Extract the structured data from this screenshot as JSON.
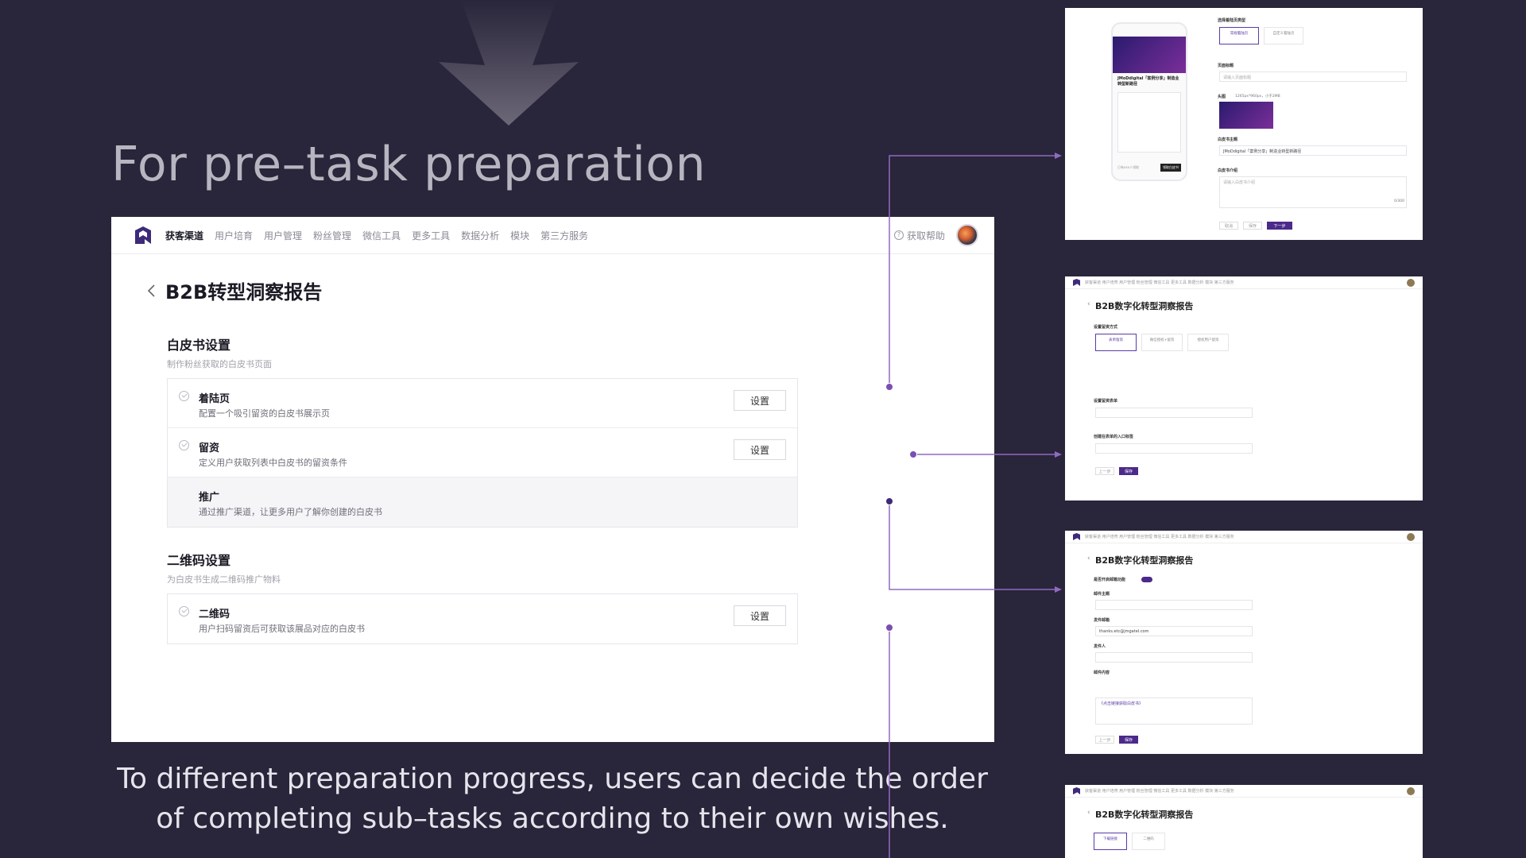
{
  "headline": "For pre–task preparation",
  "caption": "To different preparation progress, users can decide the order of completing sub–tasks according to their own wishes.",
  "colors": {
    "background": "#29253a",
    "accent": "#7a4fb2",
    "connector": "#8e6bbf"
  },
  "app": {
    "nav": {
      "logo": "logo-icon",
      "items": [
        "获客渠道",
        "用户培育",
        "用户管理",
        "粉丝管理",
        "微信工具",
        "更多工具",
        "数据分析",
        "模块",
        "第三方服务"
      ],
      "help": "获取帮助"
    },
    "page_title": "B2B转型洞察报告",
    "sections": [
      {
        "title": "白皮书设置",
        "subtitle": "制作粉丝获取的白皮书页面",
        "rows": [
          {
            "name": "着陆页",
            "desc": "配置一个吸引留资的白皮书展示页",
            "button": "设置"
          },
          {
            "name": "留资",
            "desc": "定义用户获取列表中白皮书的留资条件",
            "button": "设置"
          },
          {
            "name": "推广",
            "desc": "通过推广渠道，让更多用户了解你创建的白皮书",
            "button": ""
          }
        ]
      },
      {
        "title": "二维码设置",
        "subtitle": "为白皮书生成二维码推广物料",
        "rows": [
          {
            "name": "二维码",
            "desc": "用户扫码留资后可获取该展品对应的白皮书",
            "button": "设置"
          }
        ]
      }
    ]
  },
  "thumbs": {
    "t1": {
      "labels": [
        "选择着陆页类型",
        "页面标题",
        "头图",
        "白皮书主题",
        "白皮书介绍"
      ],
      "options": [
        "常规着陆页",
        "自定义着陆页"
      ],
      "title_placeholder": "请输入页面标题",
      "headimg_hint": "1265px*960px，小于2MB",
      "theme_value": "JMoDdigital「案例分享」制造业转型新路径",
      "intro_placeholder": "请输入白皮书介绍",
      "count": "0/300",
      "buttons": [
        "取消",
        "保存",
        "下一步"
      ],
      "phone_heading": "JMoDdigital「案例分享」制造业转型新路径",
      "phone_btn": "领取白皮书",
      "phone_foot": "已有xxx人领取"
    },
    "t2": {
      "title": "B2B数字化转型洞察报告",
      "labels": [
        "设置留资方式",
        "设置留资表单",
        "创建在表单的入口标签"
      ],
      "options": [
        "表单留资",
        "微信授权+留资",
        "授权用户留资"
      ],
      "buttons": [
        "上一步",
        "保存"
      ]
    },
    "t3": {
      "title": "B2B数字化转型洞察报告",
      "labels": [
        "是否开启邮箱功能",
        "邮件主题",
        "发件邮箱",
        "发件人",
        "邮件内容"
      ],
      "email": "thanks.etc@jmgatel.com",
      "link_text": "《点击链接获取白皮书》",
      "buttons": [
        "上一步",
        "保存"
      ]
    },
    "t4": {
      "title": "B2B数字化转型洞察报告",
      "options": [
        "下载链接",
        "二维码"
      ]
    },
    "nav_text": "获客渠道 用户培育 用户管理 粉丝管理 微信工具 更多工具 数据分析 模块 第三方服务"
  }
}
